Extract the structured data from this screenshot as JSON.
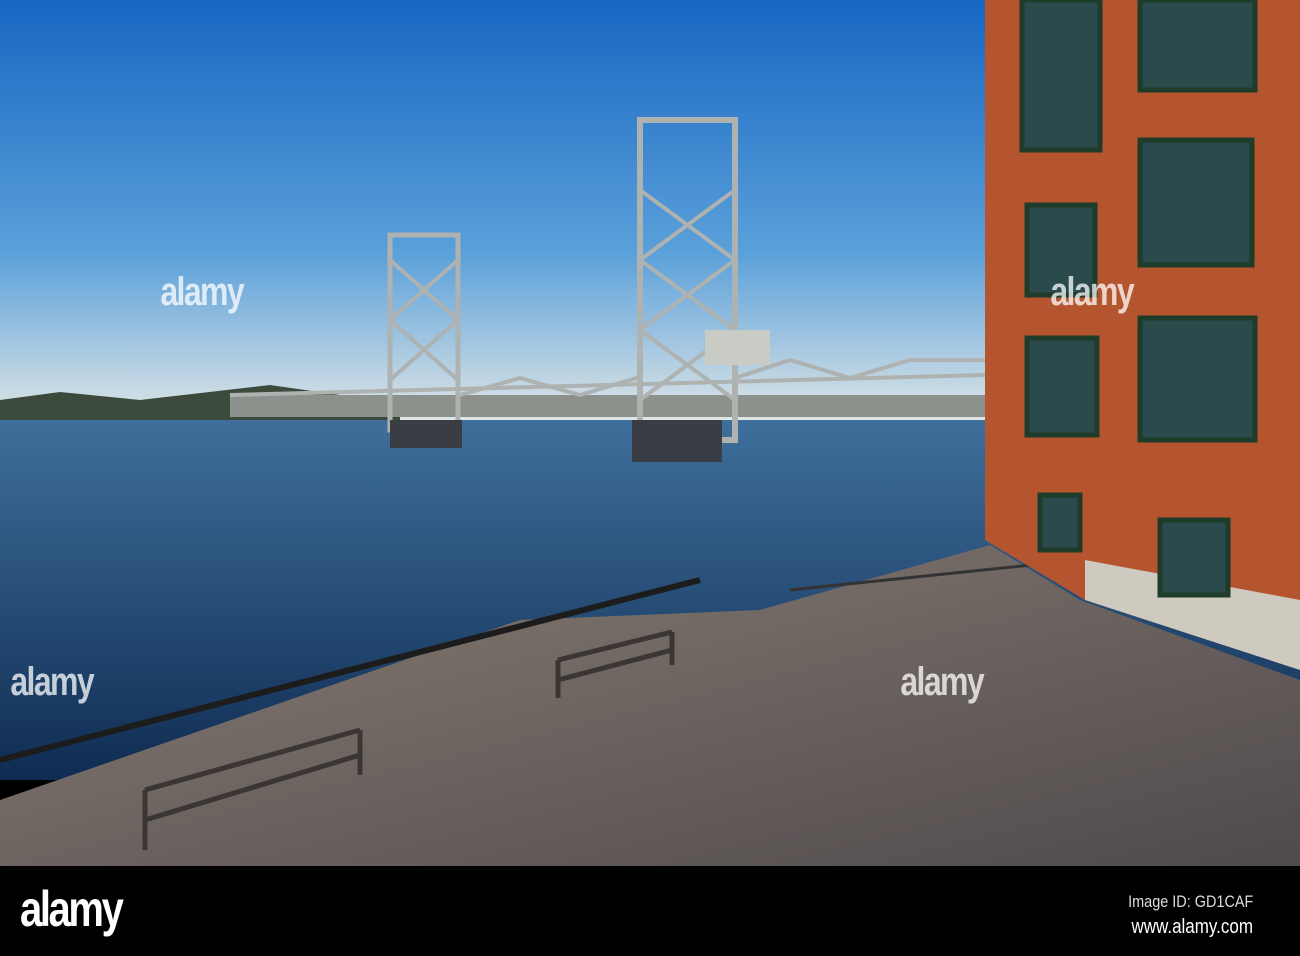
{
  "watermark": {
    "text": "alamy"
  },
  "footer": {
    "logo": "alamy",
    "image_id": "Image ID: GD1CAF",
    "url": "www.alamy.com"
  },
  "colors": {
    "sky_top": "#1766c2",
    "sky_horizon": "#d8e4ea",
    "water": "#1a3d68",
    "brick": "#b4552f",
    "deck": "#6d6461"
  }
}
